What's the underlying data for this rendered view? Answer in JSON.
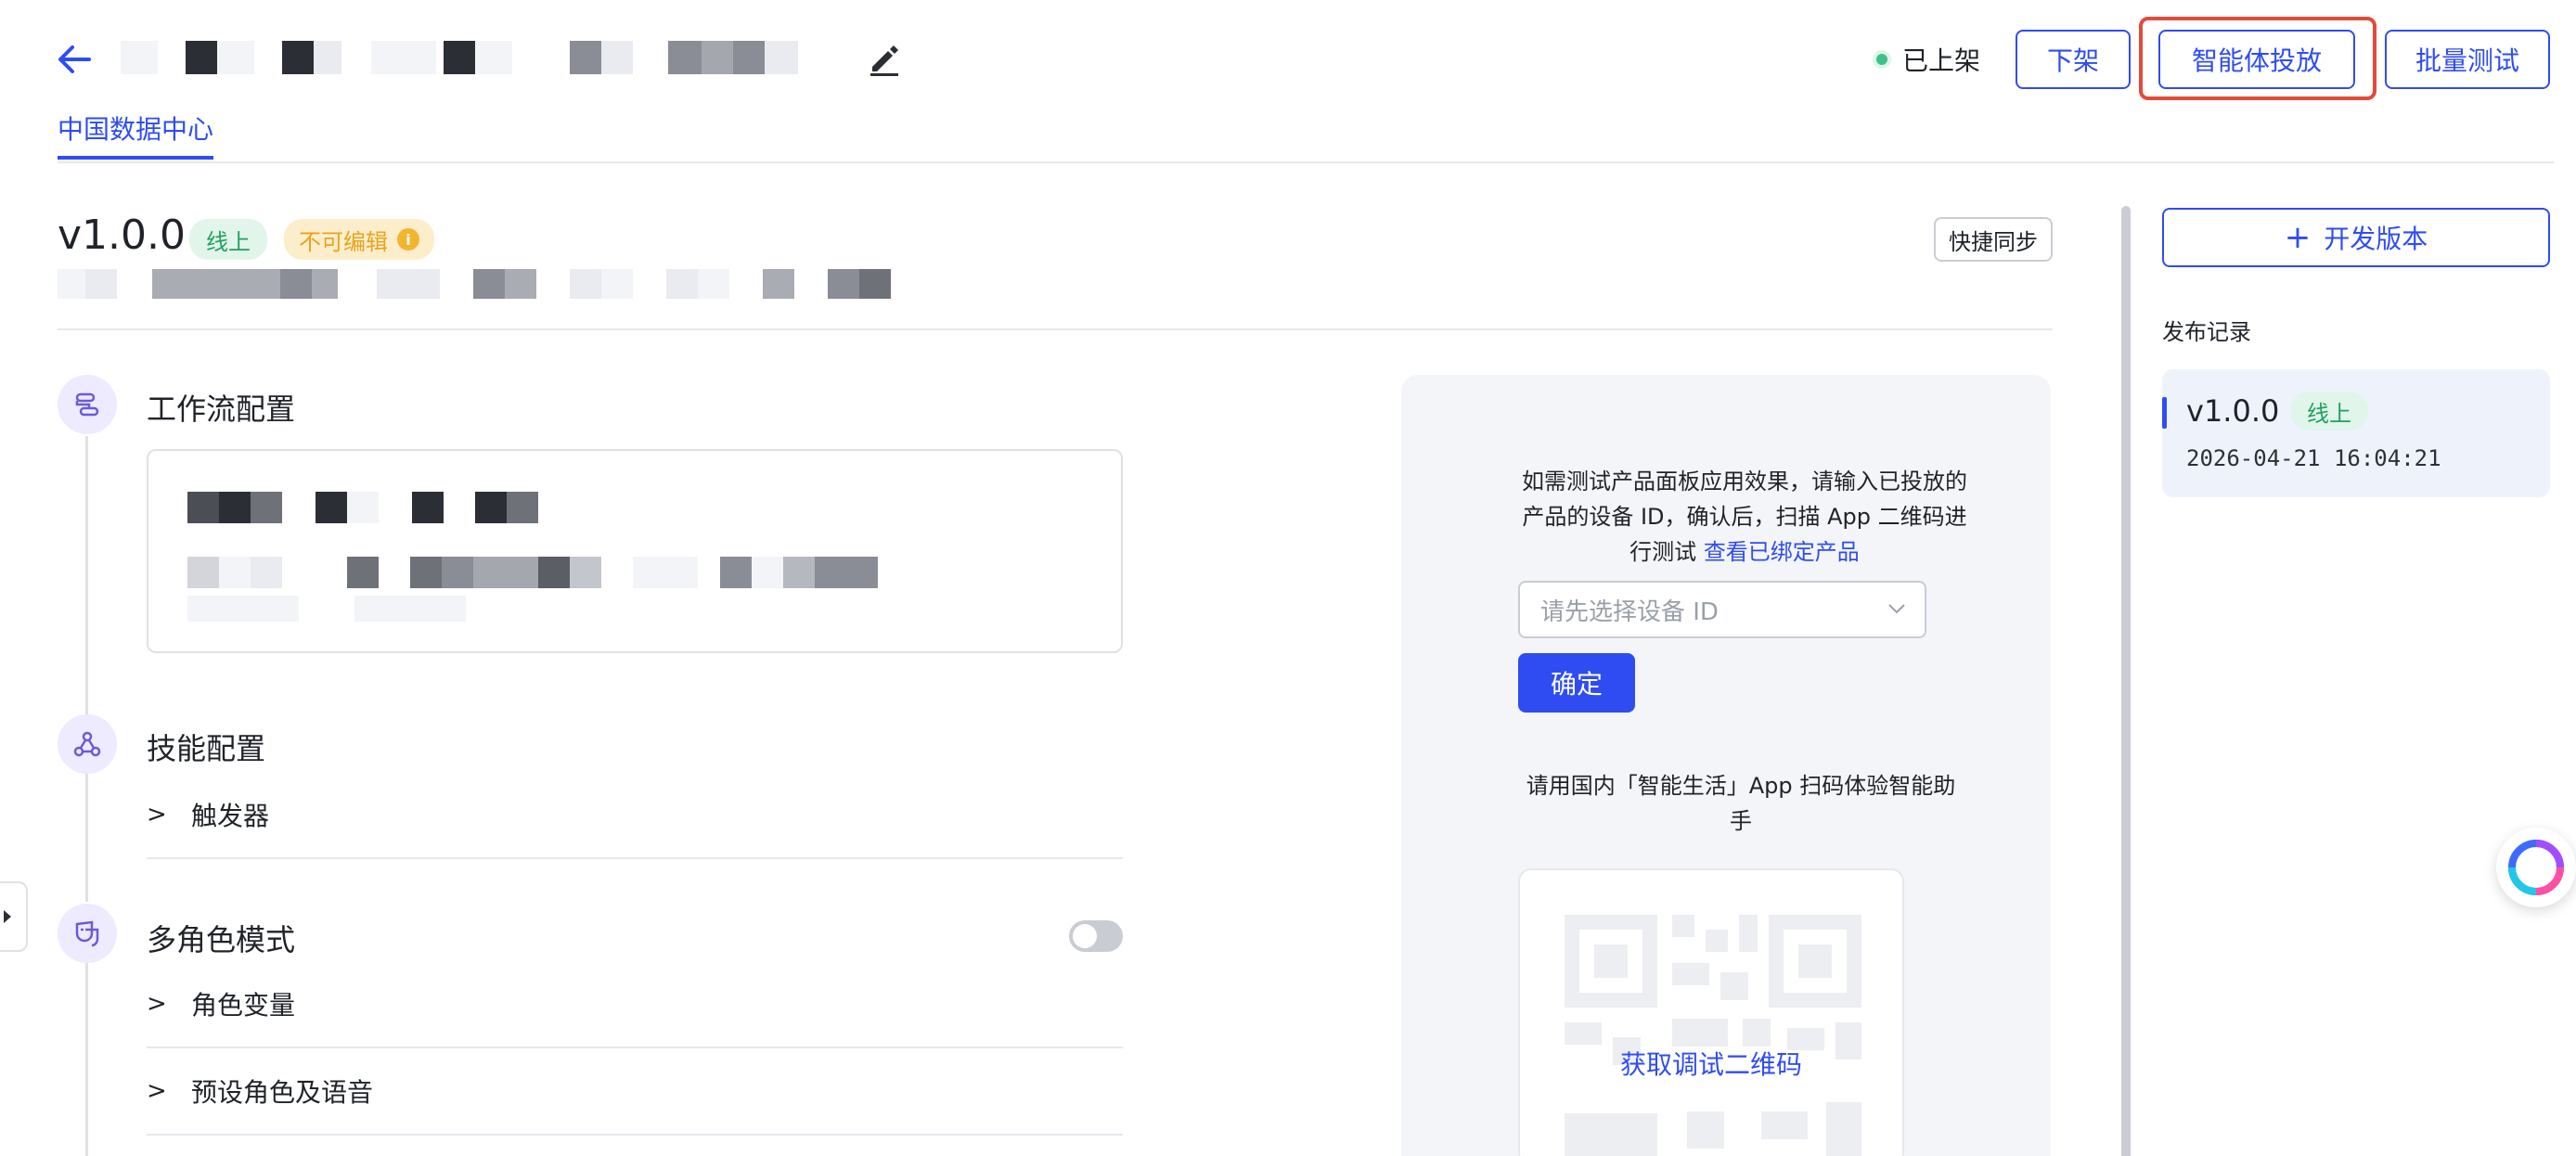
{
  "header": {
    "status_label": "已上架",
    "btn_unlist": "下架",
    "btn_deploy": "智能体投放",
    "btn_batch_test": "批量测试"
  },
  "tabs": [
    {
      "label": "中国数据中心"
    }
  ],
  "version": {
    "title": "v1.0.0",
    "tag_online": "线上",
    "tag_readonly": "不可编辑",
    "quick_sync": "快捷同步"
  },
  "sections": {
    "workflow": "工作流配置",
    "skills": "技能配置",
    "trigger": "触发器",
    "multi_role": "多角色模式",
    "role_vars": "角色变量",
    "preset_roles": "预设角色及语音"
  },
  "test_panel": {
    "desc_line1": "如需测试产品面板应用效果，请输入已投放的",
    "desc_line2": "产品的设备 ID，确认后，扫描 App 二维码进",
    "desc_line3": "行测试",
    "bound_link": "查看已绑定产品",
    "select_placeholder": "请先选择设备 ID",
    "confirm": "确定",
    "scan_line1": "请用国内「智能生活」App 扫码体验智能助",
    "scan_line2": "手",
    "qr_label": "获取调试二维码"
  },
  "right": {
    "dev_version": "开发版本",
    "records_title": "发布记录",
    "record": {
      "version": "v1.0.0",
      "tag": "线上",
      "time": "2026-04-21 16:04:21"
    }
  },
  "colors": {
    "accent": "#2f4cf2",
    "online": "#22a062",
    "readonly": "#e7a41f",
    "highlight": "#e24b3c"
  }
}
